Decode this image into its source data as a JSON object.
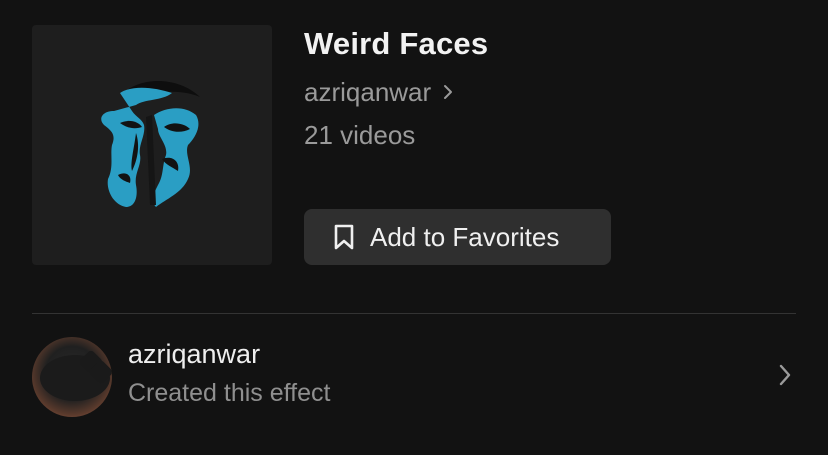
{
  "effect": {
    "title": "Weird Faces",
    "creator": "azriqanwar",
    "video_count": "21 videos",
    "thumbnail_icon": "abstract-face-artwork",
    "accent_color": "#2a9ec4"
  },
  "actions": {
    "favorite_label": "Add to Favorites",
    "favorite_icon": "bookmark-icon"
  },
  "creator_row": {
    "name": "azriqanwar",
    "subtitle": "Created this effect",
    "chevron_icon": "chevron-right-icon"
  }
}
